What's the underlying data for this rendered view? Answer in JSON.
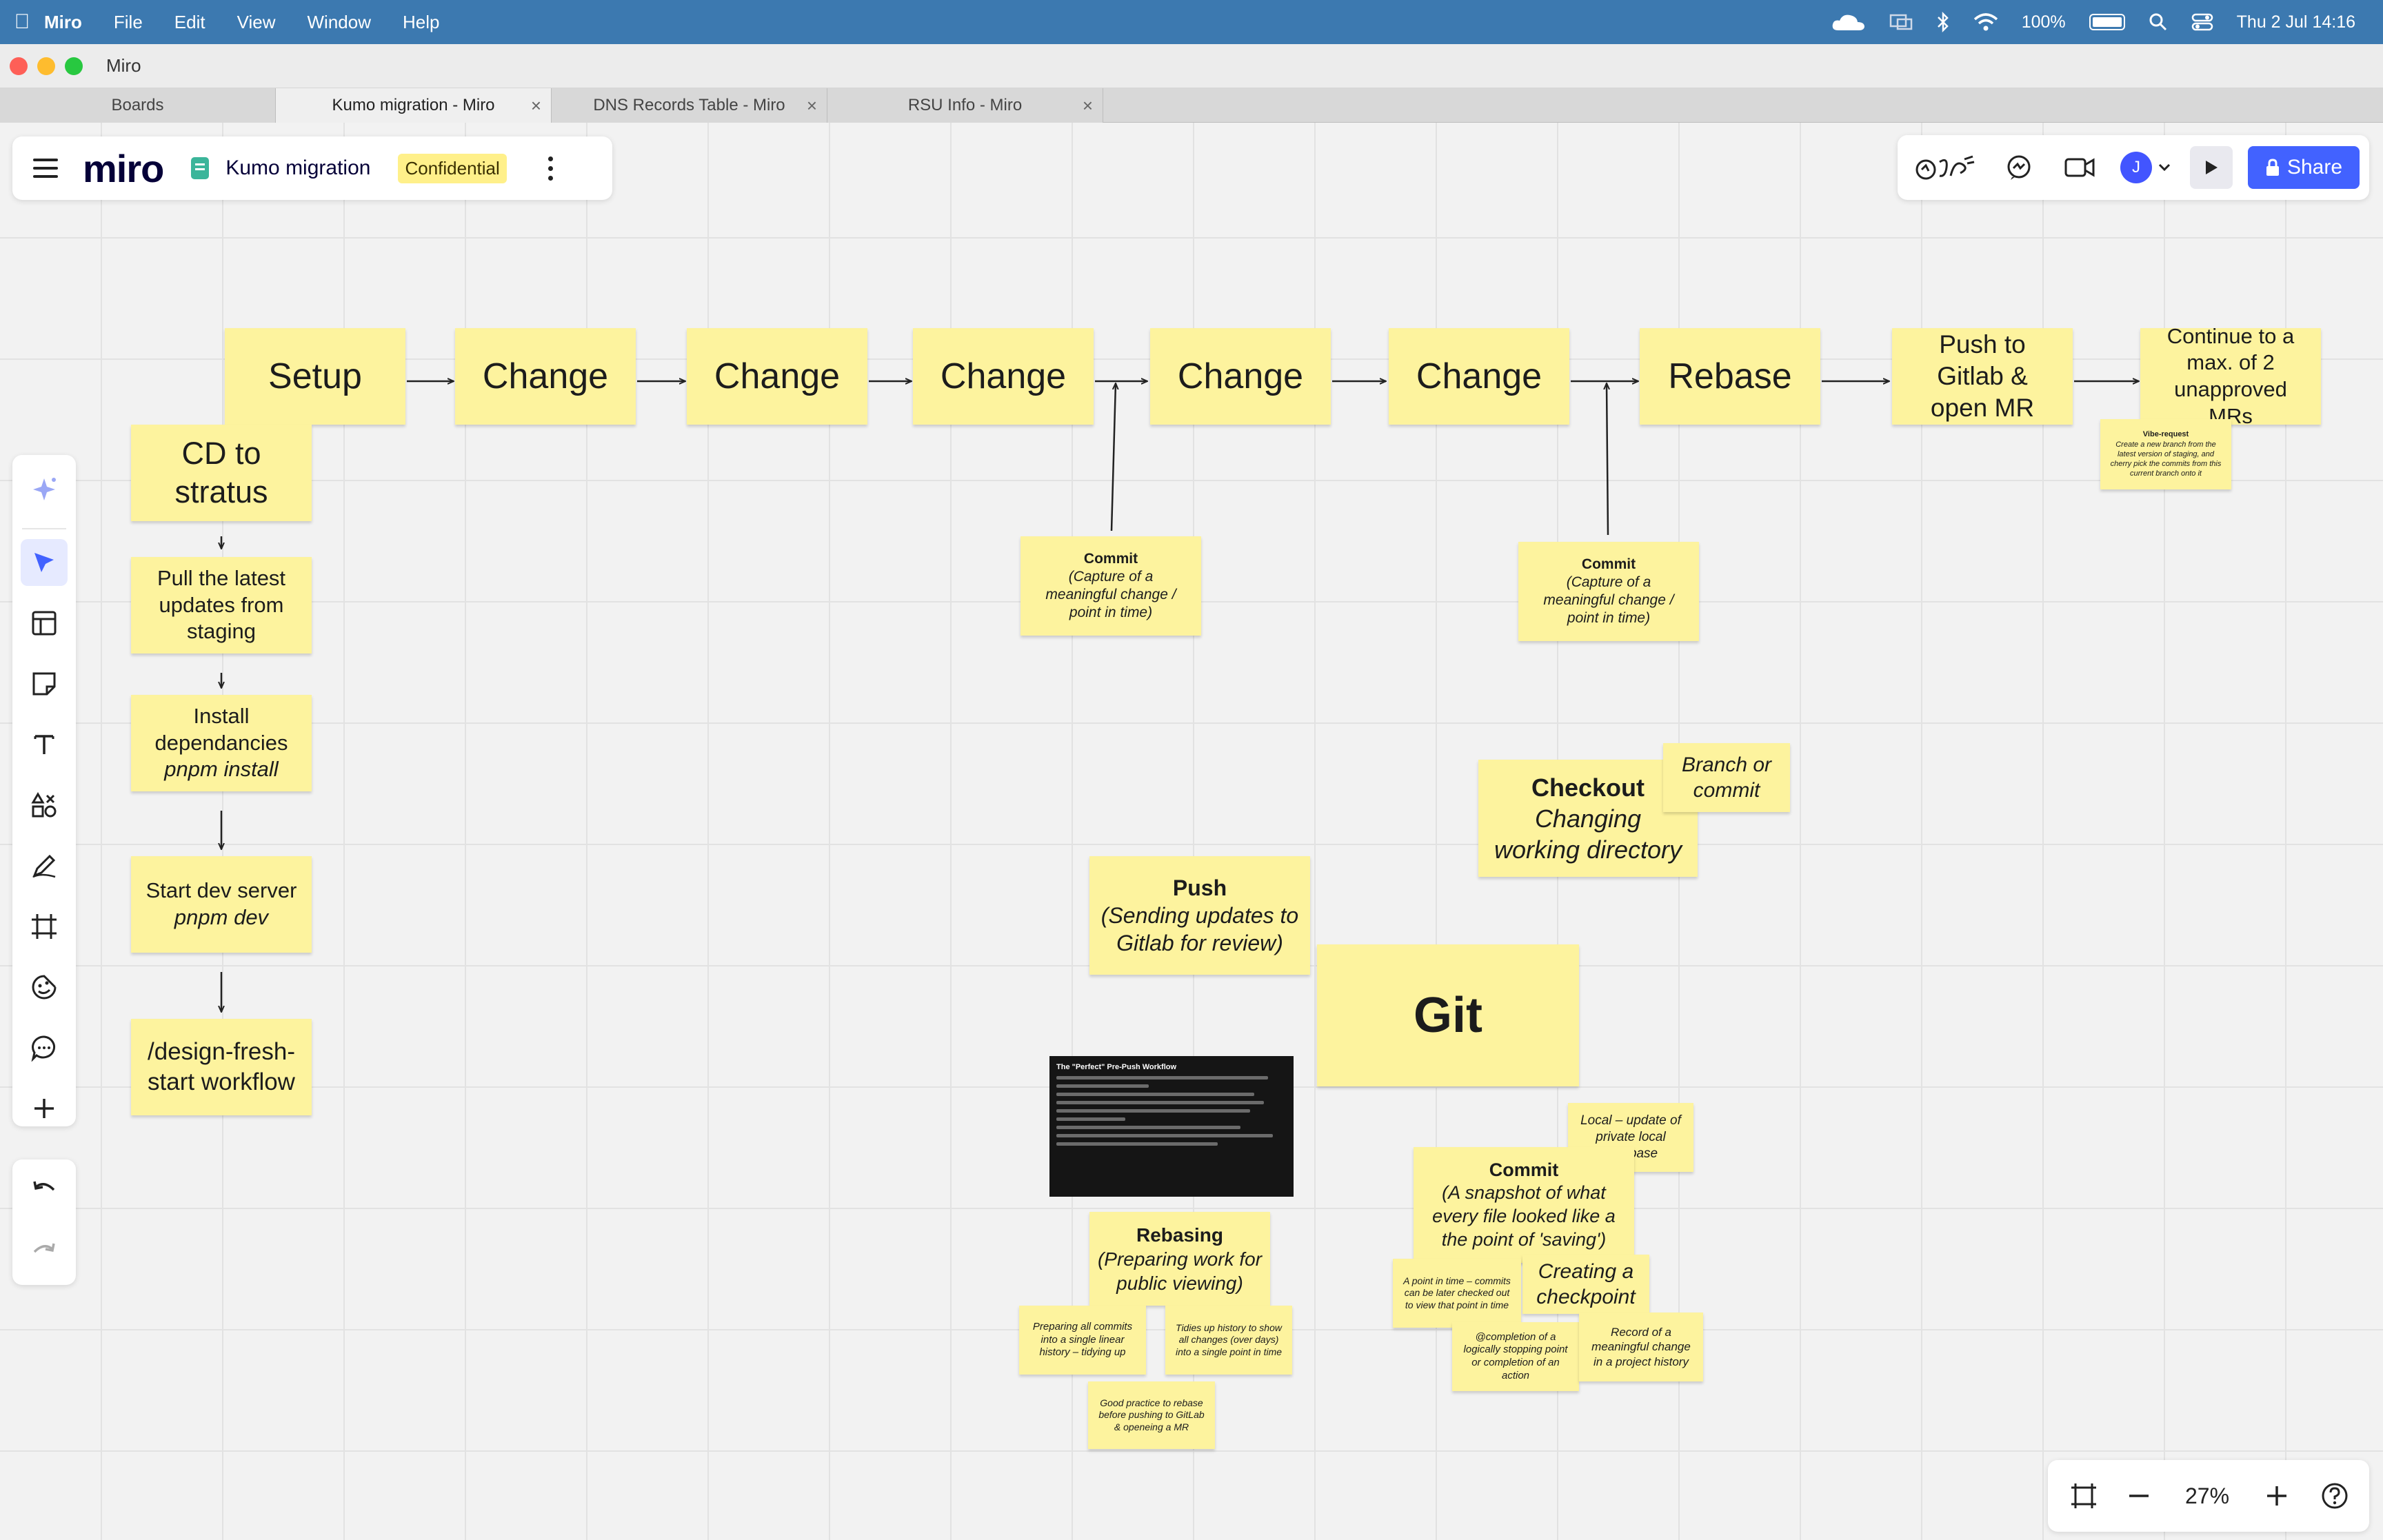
{
  "menubar": {
    "app": "Miro",
    "items": [
      "File",
      "Edit",
      "View",
      "Window",
      "Help"
    ],
    "battery": "100%",
    "datetime": "Thu 2 Jul  14:16"
  },
  "window": {
    "title": "Miro"
  },
  "tabs": [
    {
      "label": "Boards"
    },
    {
      "label": "Kumo migration - Miro"
    },
    {
      "label": "DNS Records Table - Miro"
    },
    {
      "label": "RSU Info - Miro"
    }
  ],
  "board": {
    "logo": "miro",
    "name": "Kumo migration",
    "badge": "Confidential"
  },
  "topright": {
    "avatar": "J",
    "share": "Share"
  },
  "zoom": {
    "level": "27%"
  },
  "icons": {
    "toolbar": [
      "sparkle-icon",
      "select-cursor-icon",
      "table-icon",
      "sticky-note-icon",
      "text-icon",
      "shapes-icon",
      "pen-icon",
      "frame-icon",
      "sticker-icon",
      "comment-icon",
      "plus-icon",
      "undo-icon",
      "redo-icon"
    ]
  },
  "colors": {
    "sticky": "#fdf39e",
    "accent": "#4262ff",
    "menubar": "#3c79b0"
  },
  "flow": {
    "setup": "Setup",
    "change1": "Change",
    "change2": "Change",
    "change3": "Change",
    "change4": "Change",
    "change5": "Change",
    "rebase": "Rebase",
    "push": "Push to Gitlab & open MR",
    "continue": "Continue to a max. of 2 unapproved MRs",
    "vibe_title": "Vibe-request",
    "vibe_body": "Create a new branch from the latest version of staging, and cherry pick the commits from this current branch onto it"
  },
  "commit_notes": [
    {
      "title": "Commit",
      "body": "(Capture of a meaningful change / point in time)"
    },
    {
      "title": "Commit",
      "body": "(Capture of a meaningful change / point in time)"
    }
  ],
  "setup_steps": {
    "cd": "CD to stratus",
    "pull": "Pull the latest updates from staging",
    "install": "Install dependancies",
    "install_cmd": "pnpm install",
    "dev": "Start dev server",
    "dev_cmd": "pnpm dev",
    "workflow": "/design-fresh-start workflow"
  },
  "concepts": {
    "checkout_title": "Checkout",
    "checkout_body": "Changing working directory",
    "branch": "Branch or commit",
    "push_title": "Push",
    "push_body": "(Sending updates to Gitlab for review)",
    "git": "Git",
    "local": "Local – update of private local database",
    "commit_title": "Commit",
    "commit_body": "(A snapshot of what every file looked like a the point of 'saving')",
    "creating": "Creating a checkpoint",
    "point": "A point in time – commits can be later checked out to view that point in time",
    "completion": "@completion of a logically stopping point or completion of an action",
    "record": "Record of a meaningful change in a project history",
    "rebasing_title": "Rebasing",
    "rebasing_body": "(Preparing work for public viewing)",
    "preparing": "Preparing all commits into a single linear history – tidying up",
    "tidies": "Tidies up history to show all changes (over days) into a single point in time",
    "good": "Good practice to rebase before pushing to GitLab & openeing a MR"
  },
  "doc": {
    "title": "The \"Perfect\" Pre-Push Workflow"
  }
}
